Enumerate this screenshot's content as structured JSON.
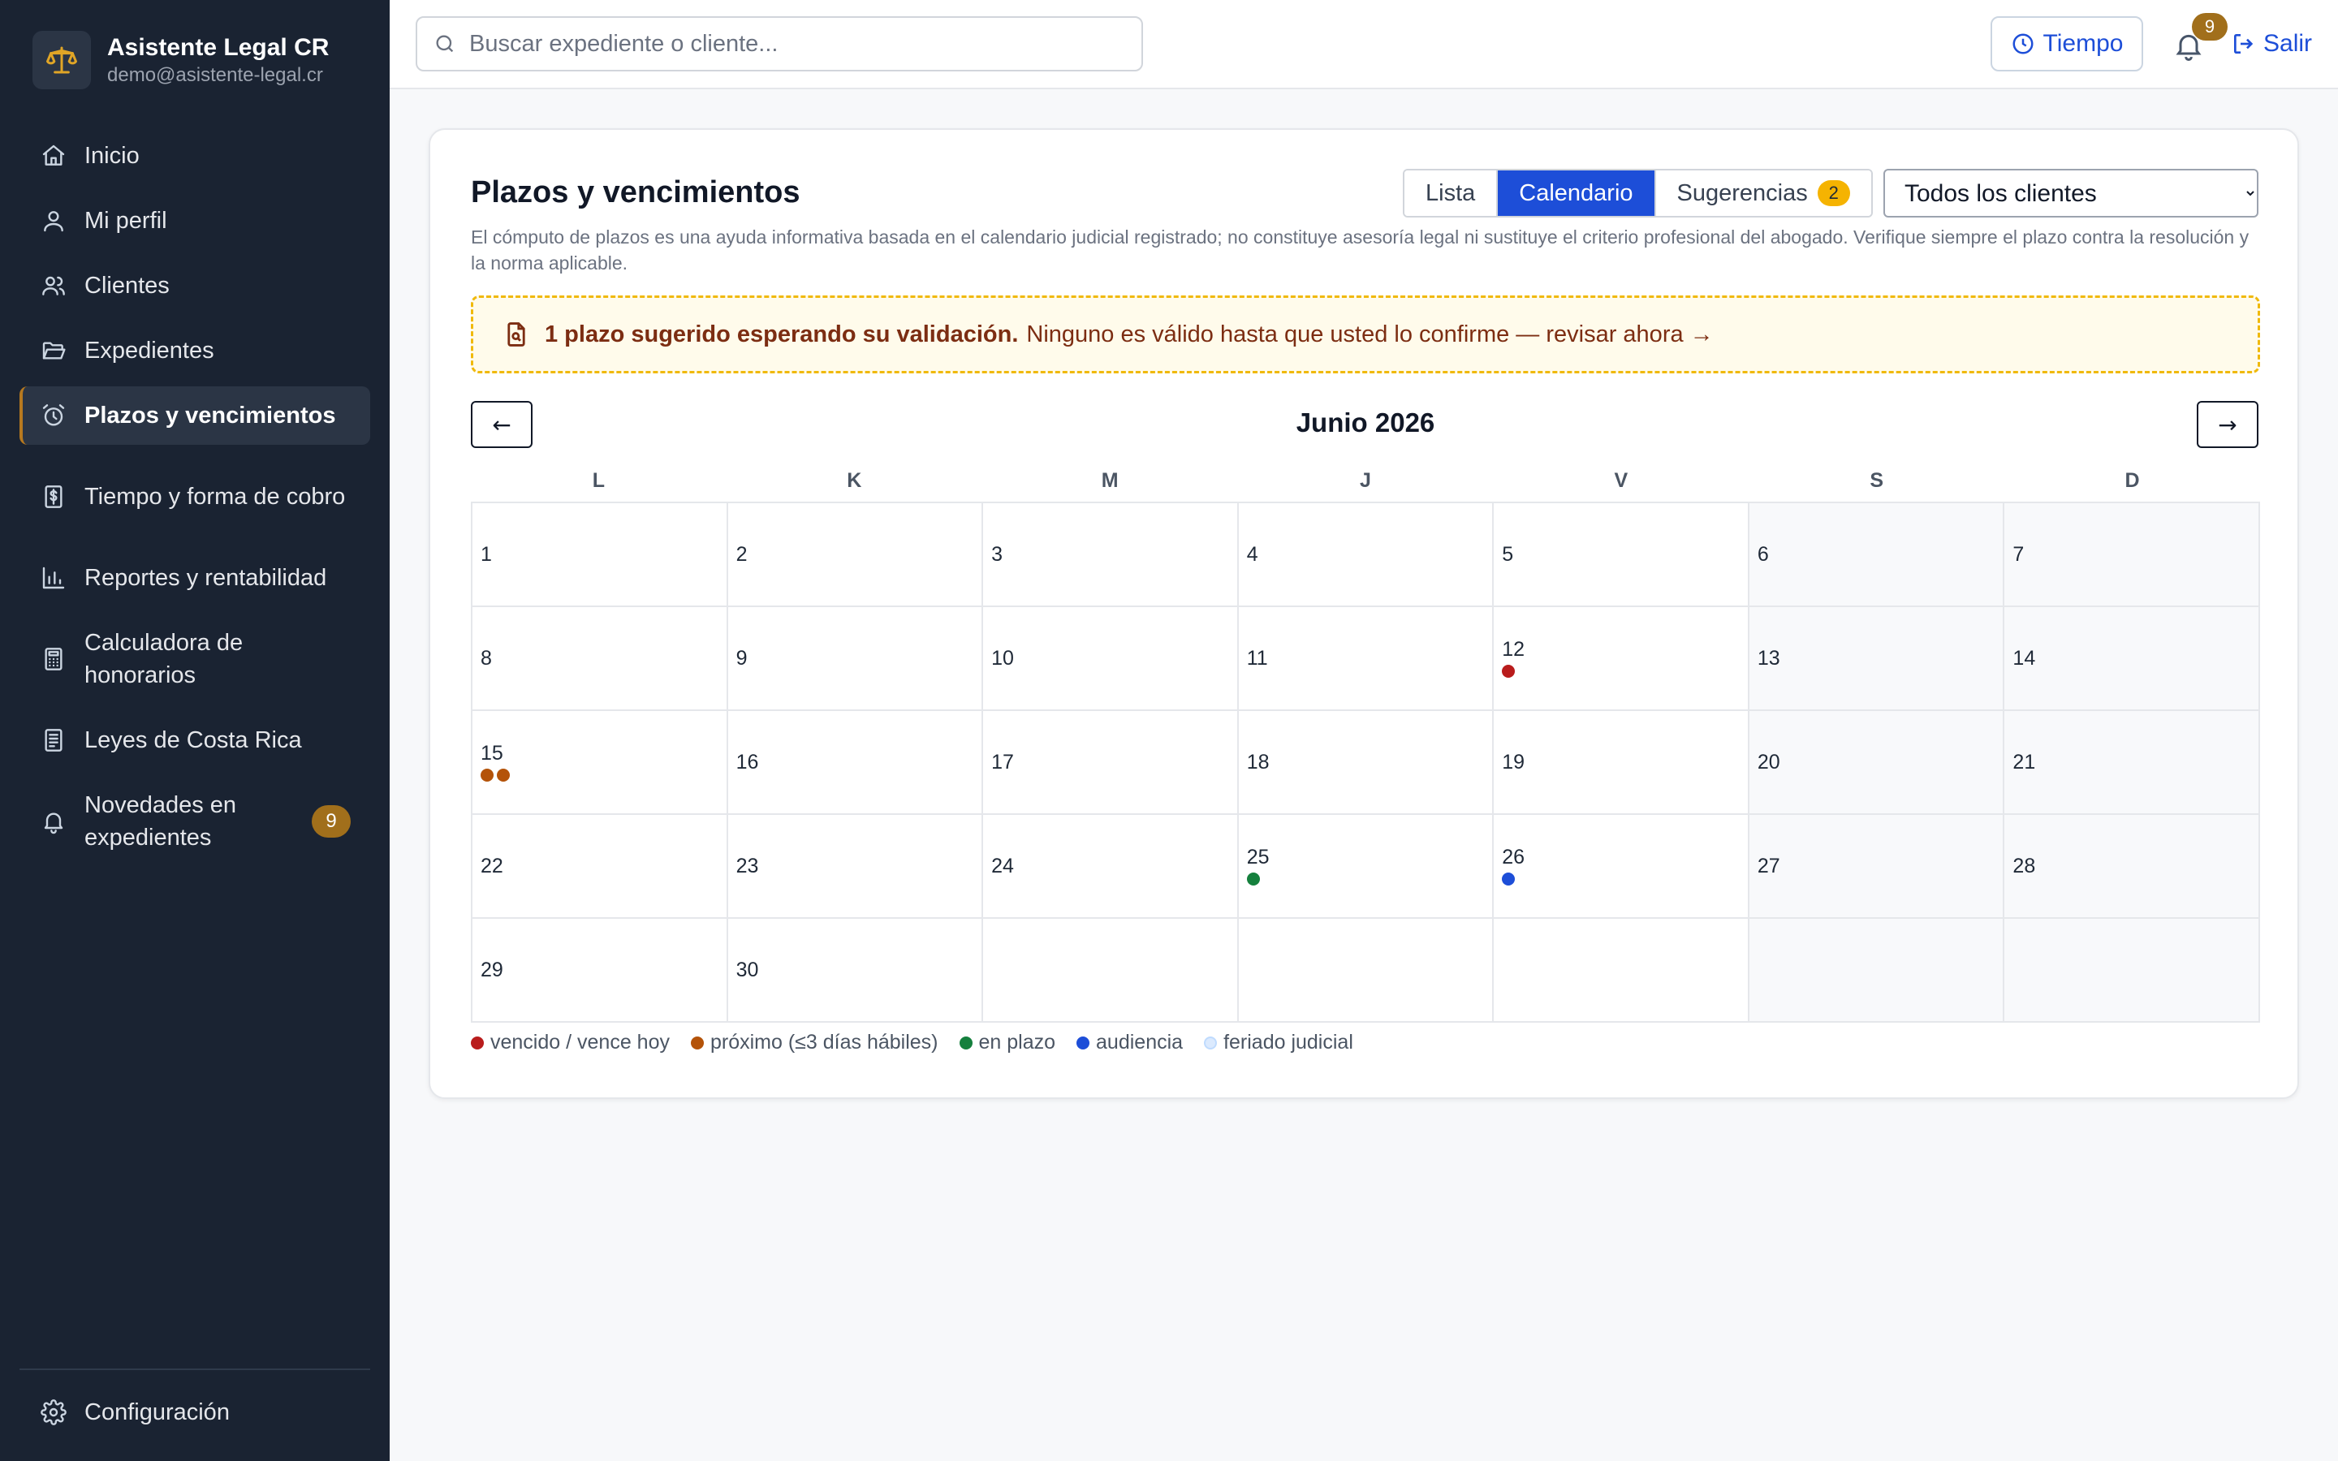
{
  "app": {
    "name": "Asistente Legal CR",
    "email": "demo@asistente-legal.cr"
  },
  "sidebar": {
    "items": [
      {
        "label": "Inicio",
        "icon": "home-icon"
      },
      {
        "label": "Mi perfil",
        "icon": "user-icon"
      },
      {
        "label": "Clientes",
        "icon": "users-icon"
      },
      {
        "label": "Expedientes",
        "icon": "folder-icon"
      },
      {
        "label": "Plazos y vencimientos",
        "icon": "alarm-clock-icon",
        "active": true
      },
      {
        "label": "Tiempo y forma de cobro",
        "icon": "receipt-dollar-icon"
      },
      {
        "label": "Reportes y rentabilidad",
        "icon": "bar-chart-icon"
      },
      {
        "label": "Calculadora de honorarios",
        "icon": "calculator-icon"
      },
      {
        "label": "Leyes de Costa Rica",
        "icon": "book-icon"
      },
      {
        "label": "Novedades en expedientes",
        "icon": "bell-icon",
        "badge": "9"
      }
    ],
    "settings_label": "Configuración"
  },
  "topbar": {
    "search_placeholder": "Buscar expediente o cliente...",
    "tiempo_label": "Tiempo",
    "notifications_count": "9",
    "logout_label": "Salir"
  },
  "page": {
    "title": "Plazos y vencimientos",
    "disclaimer": "El cómputo de plazos es una ayuda informativa basada en el calendario judicial registrado; no constituye asesoría legal ni sustituye el criterio profesional del abogado. Verifique siempre el plazo contra la resolución y la norma aplicable.",
    "tabs": [
      {
        "label": "Lista"
      },
      {
        "label": "Calendario",
        "active": true
      },
      {
        "label": "Sugerencias",
        "badge": "2"
      }
    ],
    "client_filter": {
      "selected": "Todos los clientes",
      "options": [
        "Todos los clientes"
      ]
    },
    "alert": {
      "bold": "1 plazo sugerido esperando su validación.",
      "text": "Ninguno es válido hasta que usted lo confirme — revisar ahora →"
    }
  },
  "calendar": {
    "prev_label": "←",
    "next_label": "→",
    "month_title": "Junio 2026",
    "weekdays": [
      "L",
      "K",
      "M",
      "J",
      "V",
      "S",
      "D"
    ],
    "days": [
      {
        "day": "1",
        "dots": []
      },
      {
        "day": "2",
        "dots": []
      },
      {
        "day": "3",
        "dots": []
      },
      {
        "day": "4",
        "dots": []
      },
      {
        "day": "5",
        "dots": []
      },
      {
        "day": "6",
        "dots": []
      },
      {
        "day": "7",
        "dots": []
      },
      {
        "day": "8",
        "dots": []
      },
      {
        "day": "9",
        "dots": []
      },
      {
        "day": "10",
        "dots": []
      },
      {
        "day": "11",
        "dots": []
      },
      {
        "day": "12",
        "dots": [
          "vencido"
        ]
      },
      {
        "day": "13",
        "dots": []
      },
      {
        "day": "14",
        "dots": []
      },
      {
        "day": "15",
        "dots": [
          "proximo",
          "proximo"
        ]
      },
      {
        "day": "16",
        "dots": []
      },
      {
        "day": "17",
        "dots": []
      },
      {
        "day": "18",
        "dots": []
      },
      {
        "day": "19",
        "dots": []
      },
      {
        "day": "20",
        "dots": []
      },
      {
        "day": "21",
        "dots": []
      },
      {
        "day": "22",
        "dots": []
      },
      {
        "day": "23",
        "dots": []
      },
      {
        "day": "24",
        "dots": []
      },
      {
        "day": "25",
        "dots": [
          "en_plazo"
        ]
      },
      {
        "day": "26",
        "dots": [
          "audiencia"
        ]
      },
      {
        "day": "27",
        "dots": []
      },
      {
        "day": "28",
        "dots": []
      },
      {
        "day": "29",
        "dots": []
      },
      {
        "day": "30",
        "dots": []
      },
      {
        "day": "",
        "dots": []
      },
      {
        "day": "",
        "dots": []
      },
      {
        "day": "",
        "dots": []
      },
      {
        "day": "",
        "dots": []
      },
      {
        "day": "",
        "dots": []
      }
    ],
    "legend": [
      {
        "key": "vencido",
        "label": "vencido / vence hoy"
      },
      {
        "key": "proximo",
        "label": "próximo (≤3 días hábiles)"
      },
      {
        "key": "en_plazo",
        "label": "en plazo"
      },
      {
        "key": "audiencia",
        "label": "audiencia"
      },
      {
        "key": "feriado",
        "label": "feriado judicial"
      }
    ]
  },
  "colors": {
    "vencido": "#b91c1c",
    "proximo": "#b45309",
    "en_plazo": "#15803d",
    "audiencia": "#1d4ed8",
    "feriado": "#dbeafe",
    "accent": "#1d4ed8",
    "gold": "#a16f1b",
    "sidebar_bg": "#1a2332"
  }
}
